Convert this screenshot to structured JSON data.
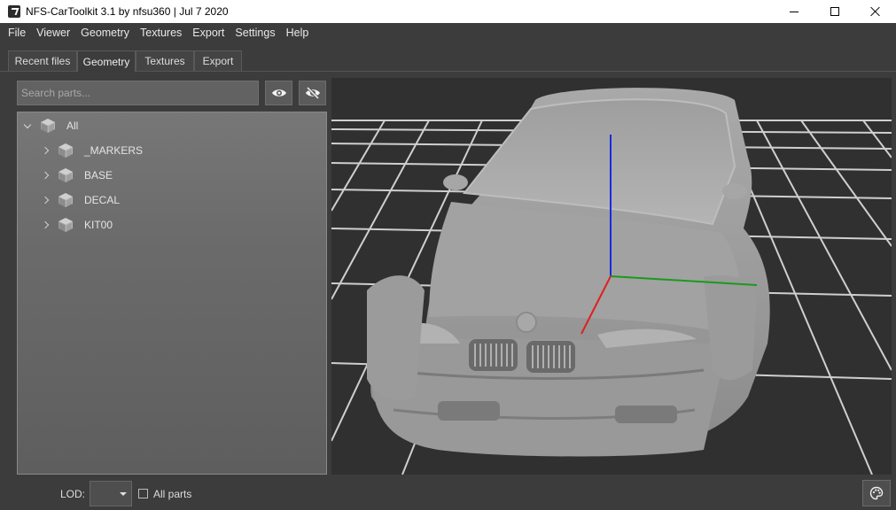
{
  "window": {
    "title": "NFS-CarToolkit 3.1 by nfsu360 | Jul  7 2020"
  },
  "menu": [
    "File",
    "Viewer",
    "Geometry",
    "Textures",
    "Export",
    "Settings",
    "Help"
  ],
  "tabs": [
    "Recent files",
    "Geometry",
    "Textures",
    "Export"
  ],
  "active_tab": "Geometry",
  "search": {
    "placeholder": "Search parts...",
    "value": ""
  },
  "buttons": {
    "show_icon": "eye-icon",
    "hide_icon": "eye-off-icon",
    "palette_icon": "palette-icon"
  },
  "tree": {
    "root": {
      "label": "All",
      "expanded": true,
      "icon": "cube-icon"
    },
    "children": [
      {
        "label": "_MARKERS",
        "icon": "cube-icon"
      },
      {
        "label": "BASE",
        "icon": "cube-icon"
      },
      {
        "label": "DECAL",
        "icon": "cube-icon"
      },
      {
        "label": "KIT00",
        "icon": "cube-icon"
      }
    ]
  },
  "bottom": {
    "lod_label": "LOD:",
    "lod_value": "",
    "all_parts_label": "All parts",
    "all_parts_checked": false
  },
  "colors": {
    "axis_x": "#e02020",
    "axis_y": "#1a9a1a",
    "axis_z": "#1a2ae0",
    "viewport_bg": "#303030",
    "grid": "#d8d8d8"
  }
}
